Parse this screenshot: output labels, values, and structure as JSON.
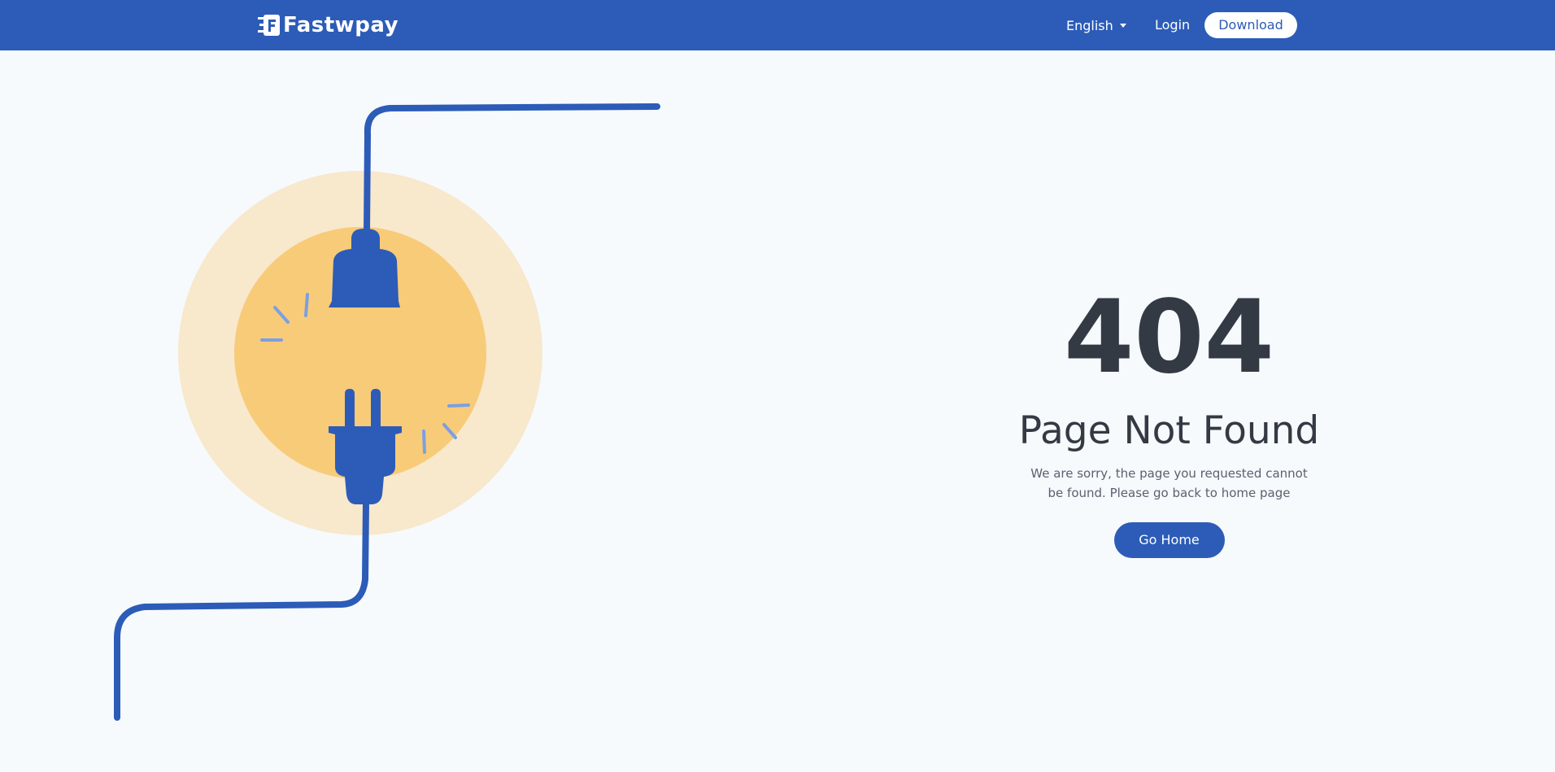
{
  "header": {
    "brand": "Fastwpay",
    "language_label": "English",
    "login_label": "Login",
    "download_label": "Download"
  },
  "main": {
    "error_code": "404",
    "title": "Page Not Found",
    "message": "We are sorry, the page you requested cannot be found. Please go back to home page",
    "button_label": "Go Home"
  },
  "colors": {
    "primary": "#2c5cb8",
    "background": "#f6fafd",
    "sun_outer": "#f8e8cc",
    "sun_inner": "#f8cb79",
    "spark": "#7c9fe3",
    "text_dark": "#343a44"
  },
  "icons": [
    "logo-icon",
    "chevron-down-icon",
    "unplugged-plugs-illustration"
  ]
}
